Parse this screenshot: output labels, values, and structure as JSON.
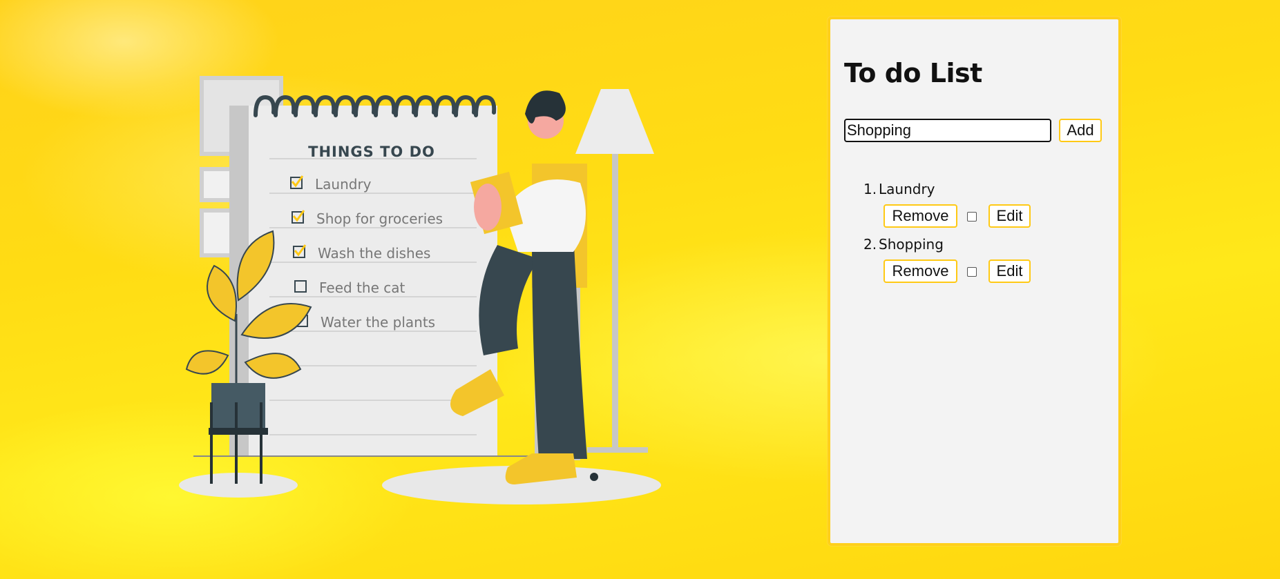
{
  "illustration": {
    "heading": "THINGS TO DO",
    "items": [
      {
        "label": "Laundry",
        "checked": true
      },
      {
        "label": "Shop for groceries",
        "checked": true
      },
      {
        "label": "Wash the dishes",
        "checked": true
      },
      {
        "label": "Feed the cat",
        "checked": false
      },
      {
        "label": "Water the plants",
        "checked": false
      }
    ]
  },
  "app": {
    "title": "To do List",
    "input_value": "Shopping",
    "add_label": "Add",
    "remove_label": "Remove",
    "edit_label": "Edit",
    "todos": [
      {
        "number": "1.",
        "text": "Laundry",
        "done": false
      },
      {
        "number": "2.",
        "text": "Shopping",
        "done": false
      }
    ]
  },
  "colors": {
    "accent": "#ffc914",
    "panel_bg": "#f3f3f3",
    "dark": "#37474f"
  }
}
